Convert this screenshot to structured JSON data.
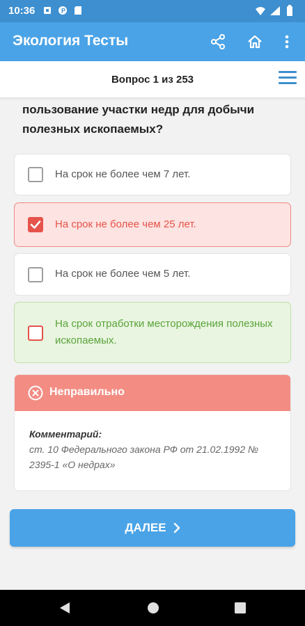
{
  "status": {
    "time": "10:36",
    "left_icons": [
      "square-notification-icon",
      "p-badge-icon",
      "sd-card-icon"
    ],
    "right_icons": [
      "wifi-icon",
      "signal-icon",
      "battery-icon"
    ]
  },
  "appbar": {
    "title": "Экология Тесты",
    "actions": [
      "share-icon",
      "home-icon",
      "more-vert-icon"
    ]
  },
  "question_bar": {
    "counter": "Вопрос 1 из 253"
  },
  "question": {
    "text": "пользование участки недр для добычи полезных ископаемых?"
  },
  "options": [
    {
      "text": "На срок не более чем 7 лет.",
      "state": "normal",
      "checked": false
    },
    {
      "text": "На срок не более чем 25 лет.",
      "state": "wrong",
      "checked": true
    },
    {
      "text": "На срок не более чем 5 лет.",
      "state": "normal",
      "checked": false
    },
    {
      "text": "На срок отработки месторождения полезных ископаемых.",
      "state": "right",
      "checked": false
    }
  ],
  "result": {
    "label": "Неправильно",
    "comment_title": "Комментарий:",
    "comment_text": "ст. 10 Федерального закона РФ от 21.02.1992 № 2395-1 «О недрах»"
  },
  "next_button": {
    "label": "ДАЛЕЕ"
  },
  "colors": {
    "appbar": "#4aa3e6",
    "wrong": "#e5534b",
    "right": "#5aa33b",
    "result_header": "#f38d84"
  }
}
